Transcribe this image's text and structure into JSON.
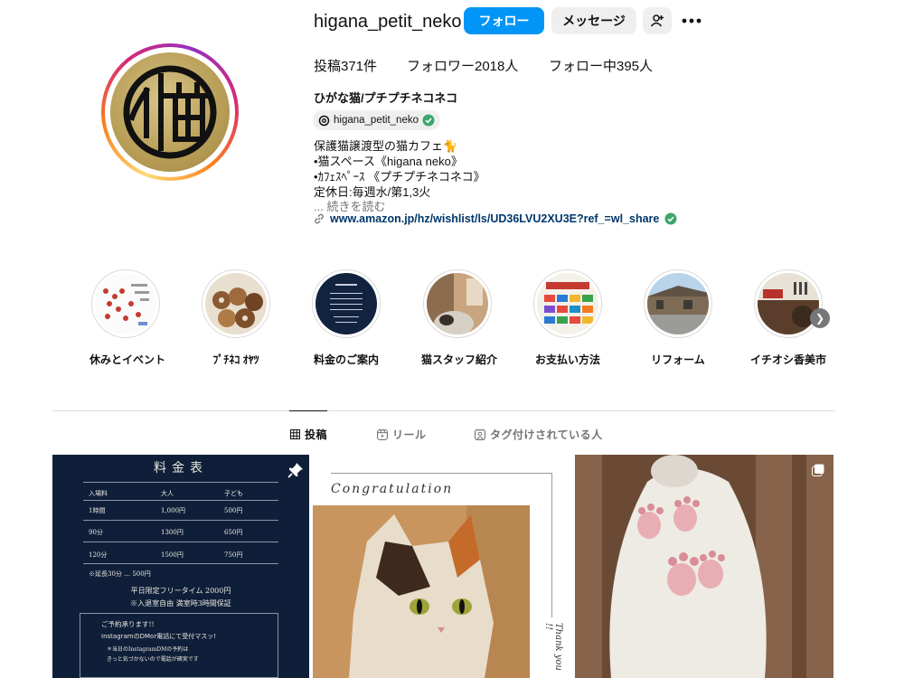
{
  "header": {
    "username": "higana_petit_neko",
    "follow_label": "フォロー",
    "message_label": "メッセージ",
    "more_icon": "more-horizontal-icon",
    "add_user_icon": "add-user-icon"
  },
  "stats": {
    "posts": "投稿371件",
    "followers": "フォロワー2018人",
    "following": "フォロー中395人"
  },
  "bio": {
    "name": "ひがな猫/プチプチネコネコ",
    "threads_handle": "higana_petit_neko",
    "lines": [
      "保護猫譲渡型の猫カフェ🐈",
      "•猫スペース《higana neko》",
      "•ｶﾌｪｽﾍﾟｰｽ 《プチプチネコネコ》",
      "定休日:毎週水/第1,3火"
    ],
    "more": "... 続きを読む",
    "link": "www.amazon.jp/hz/wishlist/ls/UD36LVU2XU3E?ref_=wl_share"
  },
  "highlights": [
    {
      "label": "休みとイベント"
    },
    {
      "label": "ﾌﾟﾁﾈｺ ｵﾔﾂ"
    },
    {
      "label": "料金のご案内"
    },
    {
      "label": "猫スタッフ紹介"
    },
    {
      "label": "お支払い方法"
    },
    {
      "label": "リフォーム"
    },
    {
      "label": "イチオシ香美市"
    }
  ],
  "tabs": {
    "posts": "投稿",
    "reels": "リール",
    "tagged": "タグ付けされている人"
  },
  "posts": {
    "price_card": {
      "title": "料金表",
      "head": [
        "入場料",
        "大人",
        "子ども"
      ],
      "rows": [
        [
          "1時間",
          "1,000円",
          "500円"
        ],
        [
          "90分",
          "1300円",
          "650円"
        ],
        [
          "120分",
          "1500円",
          "750円"
        ]
      ],
      "extension": "※延長30分 … 500円",
      "free_time": "平日限定フリータイム 2000円",
      "free_note": "※入退室自由 満室時3時間保証",
      "reserve": "ご予約承ります!!",
      "reserve_how": "InstagramのDMor電話にて受付マスッ!",
      "reserve_note": "＊当日のInstagramDMの予約は",
      "reserve_note2": "きっと気づかないので電話が確実です"
    },
    "congrats": "Congratulation",
    "thanks": "Thank you !!"
  }
}
